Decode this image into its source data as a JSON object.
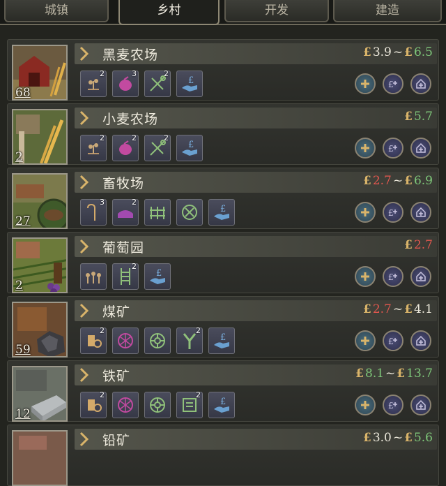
{
  "tabs": [
    {
      "label": "城镇",
      "active": false
    },
    {
      "label": "乡村",
      "active": true
    },
    {
      "label": "开发",
      "active": false
    },
    {
      "label": "建造",
      "active": false
    }
  ],
  "currency_symbol": "£",
  "rows": [
    {
      "name": "黑麦农场",
      "count": "68",
      "price_low": "3.9",
      "price_low_color": "white",
      "price_high": "6.5",
      "price_high_color": "green",
      "has_range": true,
      "icons": [
        {
          "name": "sprout-icon",
          "level": "2"
        },
        {
          "name": "fertilizer-icon",
          "level": "3"
        },
        {
          "name": "tools-icon",
          "level": "2"
        },
        {
          "name": "subsidy-icon",
          "level": ""
        }
      ]
    },
    {
      "name": "小麦农场",
      "count": "2",
      "price_low": "",
      "price_low_color": "white",
      "price_high": "5.7",
      "price_high_color": "green",
      "has_range": false,
      "icons": [
        {
          "name": "sprout-icon",
          "level": "2"
        },
        {
          "name": "fertilizer-icon",
          "level": "2"
        },
        {
          "name": "tools-icon",
          "level": "2"
        },
        {
          "name": "subsidy-icon",
          "level": ""
        }
      ]
    },
    {
      "name": "畜牧场",
      "count": "27",
      "price_low": "2.7",
      "price_low_color": "red",
      "price_high": "6.9",
      "price_high_color": "green",
      "has_range": true,
      "icons": [
        {
          "name": "crook-icon",
          "level": "3"
        },
        {
          "name": "feed-trough-icon",
          "level": "2"
        },
        {
          "name": "fence-icon",
          "level": ""
        },
        {
          "name": "vaccine-icon",
          "level": ""
        },
        {
          "name": "subsidy-icon",
          "level": ""
        }
      ]
    },
    {
      "name": "葡萄园",
      "count": "2",
      "price_low": "",
      "price_low_color": "white",
      "price_high": "2.7",
      "price_high_color": "red",
      "has_range": false,
      "icons": [
        {
          "name": "vines-icon",
          "level": ""
        },
        {
          "name": "trellis-icon",
          "level": "2"
        },
        {
          "name": "subsidy-icon",
          "level": ""
        }
      ]
    },
    {
      "name": "煤矿",
      "count": "59",
      "price_low": "2.7",
      "price_low_color": "red",
      "price_high": "4.1",
      "price_high_color": "white",
      "has_range": true,
      "icons": [
        {
          "name": "drill-icon",
          "level": "2"
        },
        {
          "name": "explosives-icon",
          "level": ""
        },
        {
          "name": "safety-gear-icon",
          "level": ""
        },
        {
          "name": "pipe-icon",
          "level": "2"
        },
        {
          "name": "subsidy-icon",
          "level": ""
        }
      ]
    },
    {
      "name": "铁矿",
      "count": "12",
      "price_low": "8.1",
      "price_low_color": "green",
      "price_high": "13.7",
      "price_high_color": "green",
      "has_range": true,
      "icons": [
        {
          "name": "drill-icon",
          "level": "2"
        },
        {
          "name": "explosives-icon",
          "level": ""
        },
        {
          "name": "safety-gear-icon",
          "level": ""
        },
        {
          "name": "blueprint-icon",
          "level": "2"
        },
        {
          "name": "subsidy-icon",
          "level": ""
        }
      ]
    },
    {
      "name": "铅矿",
      "count": "",
      "price_low": "3.0",
      "price_low_color": "white",
      "price_high": "5.6",
      "price_high_color": "green",
      "has_range": true,
      "icons": []
    }
  ],
  "colors": {
    "white": "#ece8db",
    "green": "#7fc87a",
    "red": "#e0574e",
    "gold": "#d9b46a"
  }
}
